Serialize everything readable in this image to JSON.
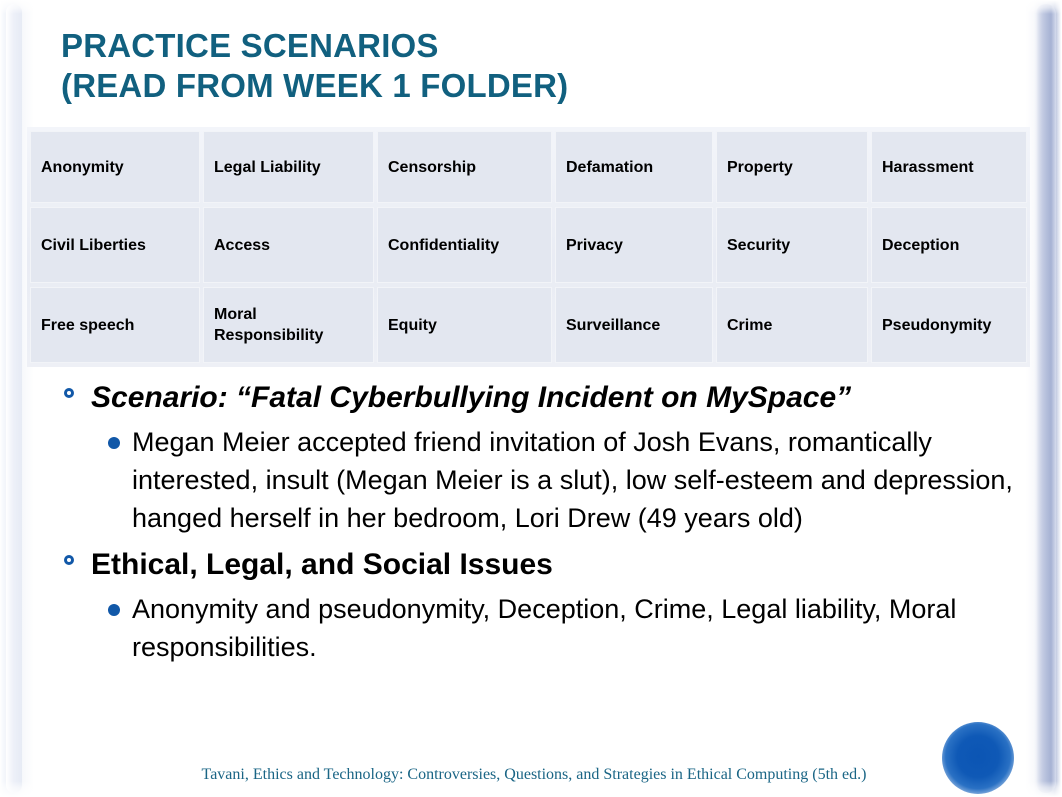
{
  "slide": {
    "title_line1": "Practice Scenarios",
    "title_line2": "(read from Week 1 folder)",
    "title_color": "#11607f",
    "background_color": "#ffffff"
  },
  "table": {
    "cell_background": "#e3e7f0",
    "rows": [
      [
        "Anonymity",
        "Legal Liability",
        "Censorship",
        "Defamation",
        "Property",
        "Harassment"
      ],
      [
        "Civil Liberties",
        "Access",
        "Confidentiality",
        "Privacy",
        "Security",
        "Deception"
      ],
      [
        "Free speech",
        "Moral Responsibility",
        "Equity",
        "Surveillance",
        "Crime",
        "Pseudonymity"
      ]
    ]
  },
  "content": {
    "bullet1": {
      "text": "Scenario: “Fatal Cyberbullying Incident on MySpace”",
      "sub1": "Megan Meier accepted friend invitation of Josh Evans, romantically interested, insult (Megan Meier is a slut), low self-esteem and depression, hanged herself in her bedroom, Lori Drew (49 years old)"
    },
    "bullet2": {
      "text": "Ethical, Legal, and Social Issues",
      "sub1": "Anonymity and pseudonymity, Deception, Crime, Legal liability, Moral responsibilities."
    },
    "marker_color": "#1158a8"
  },
  "footer": {
    "citation": "Tavani, Ethics and Technology: Controversies, Questions, and Strategies in Ethical Computing (5th ed.)",
    "color": "#1a6585"
  },
  "decor": {
    "circle_color": "#0b55b4",
    "frame_color": "#b0bbd8"
  }
}
